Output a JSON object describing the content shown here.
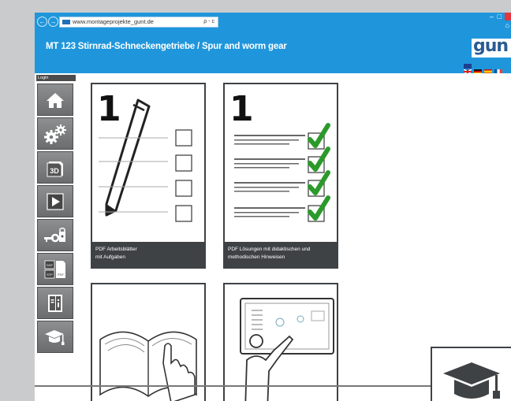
{
  "browser": {
    "url": "www.montageprojekte_gunt.de",
    "address_icons": "ρ - c",
    "back_glyph": "←",
    "forward_glyph": "→",
    "minimize_glyph": "–",
    "maximize_glyph": "□",
    "home_glyph": "⌂"
  },
  "app": {
    "title": "MT 123 Stirnrad-Schneckengetriebe / Spur and worm gear",
    "logo_text": "gun",
    "header_color": "#1f96dc"
  },
  "sidebar": {
    "login_label": "Login",
    "items": [
      {
        "icon": "home-icon"
      },
      {
        "icon": "gears-icon"
      },
      {
        "icon": "3d-model-icon",
        "label": "3D"
      },
      {
        "icon": "play-video-icon"
      },
      {
        "icon": "key-lock-icon"
      },
      {
        "icon": "file-formats-icon",
        "labels": [
          "DXF",
          "STP",
          "PDF"
        ]
      },
      {
        "icon": "book-info-icon"
      },
      {
        "icon": "graduation-cap-icon"
      }
    ]
  },
  "cards": [
    {
      "number": "1",
      "caption_line1": "PDF Arbeitsblätter",
      "caption_line2": "mit Aufgaben"
    },
    {
      "number": "1",
      "caption_line1": "PDF Lösungen mit didaktischen und",
      "caption_line2": "methodischen Hinweisen"
    },
    {
      "icon": "open-book-icon"
    },
    {
      "icon": "presentation-board-icon"
    }
  ],
  "colors": {
    "accent": "#1f96dc",
    "check_green": "#2b9a2b",
    "sidebar_button": "#7a7b7c",
    "caption_bg": "#3f4245"
  }
}
